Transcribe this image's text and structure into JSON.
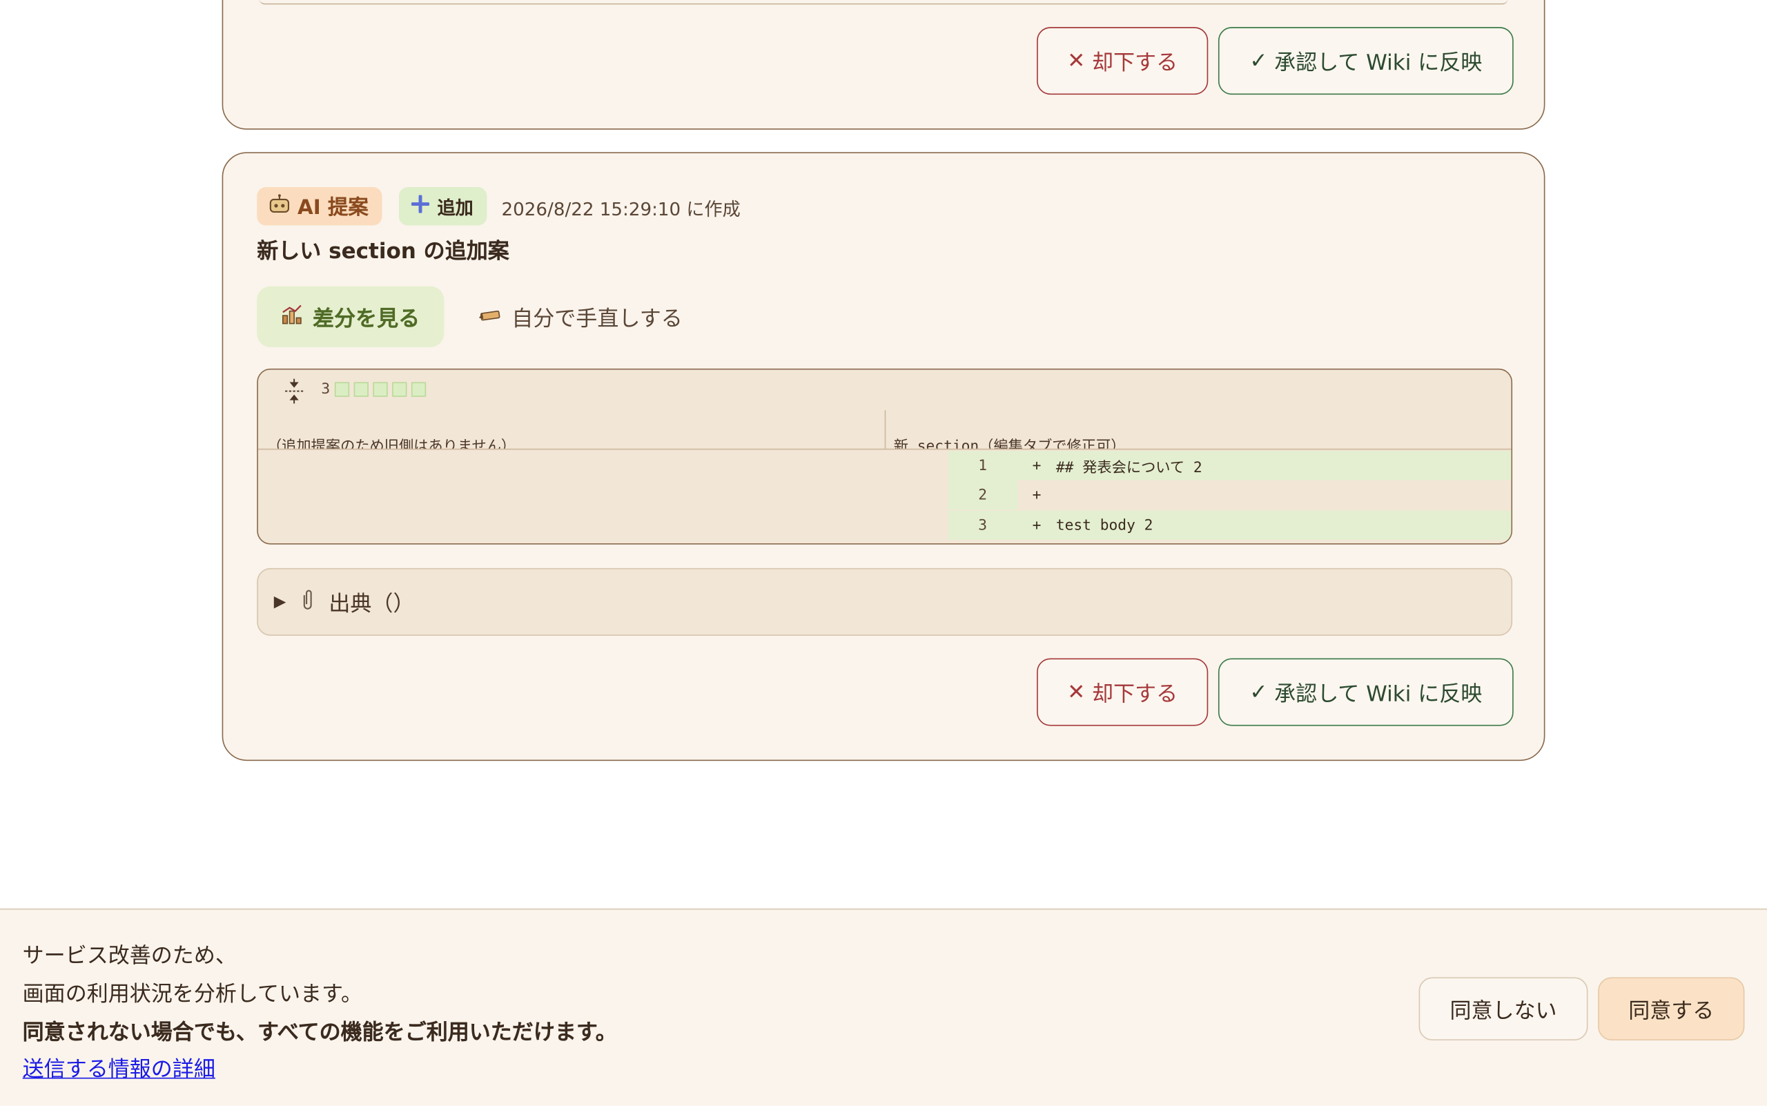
{
  "colors": {
    "accent_reject": "#a5383a",
    "accent_approve": "#3b7a47",
    "ai_tag_bg": "#fbdcbe",
    "add_tag_bg": "#dfeecb",
    "diff_add_bg": "#e3efd0",
    "card_bg": "#faf4ec"
  },
  "top_card": {
    "reject_label": "却下する",
    "approve_label": "承認して Wiki に反映"
  },
  "proposal": {
    "ai_tag": "AI 提案",
    "add_tag": "追加",
    "created": "2026/8/22 15:29:10 に作成",
    "title": "新しい section の追加案",
    "tab_diff": "差分を見る",
    "tab_edit": "自分で手直しする",
    "diff": {
      "count": "3",
      "left_header": "（追加提案のため旧側はありません）",
      "right_header": "新 section（編集タブで修正可）",
      "rows": [
        {
          "num": "1",
          "sign": "+",
          "text": "## 発表会について 2"
        },
        {
          "num": "2",
          "sign": "+",
          "text": ""
        },
        {
          "num": "3",
          "sign": "+",
          "text": "test body 2"
        }
      ]
    },
    "sources_label": "出典（）",
    "reject_label": "却下する",
    "approve_label": "承認して Wiki に反映"
  },
  "consent": {
    "line1": "サービス改善のため、",
    "line2": "画面の利用状況を分析しています。",
    "line3": "同意されない場合でも、すべての機能をご利用いただけます。",
    "link": "送信する情報の詳細",
    "decline": "同意しない",
    "accept": "同意する"
  },
  "icons": [
    "close-icon",
    "check-icon",
    "robot-icon",
    "plus-icon",
    "chart-icon",
    "pencil-icon",
    "expand-icon",
    "triangle-right-icon",
    "paperclip-icon"
  ]
}
